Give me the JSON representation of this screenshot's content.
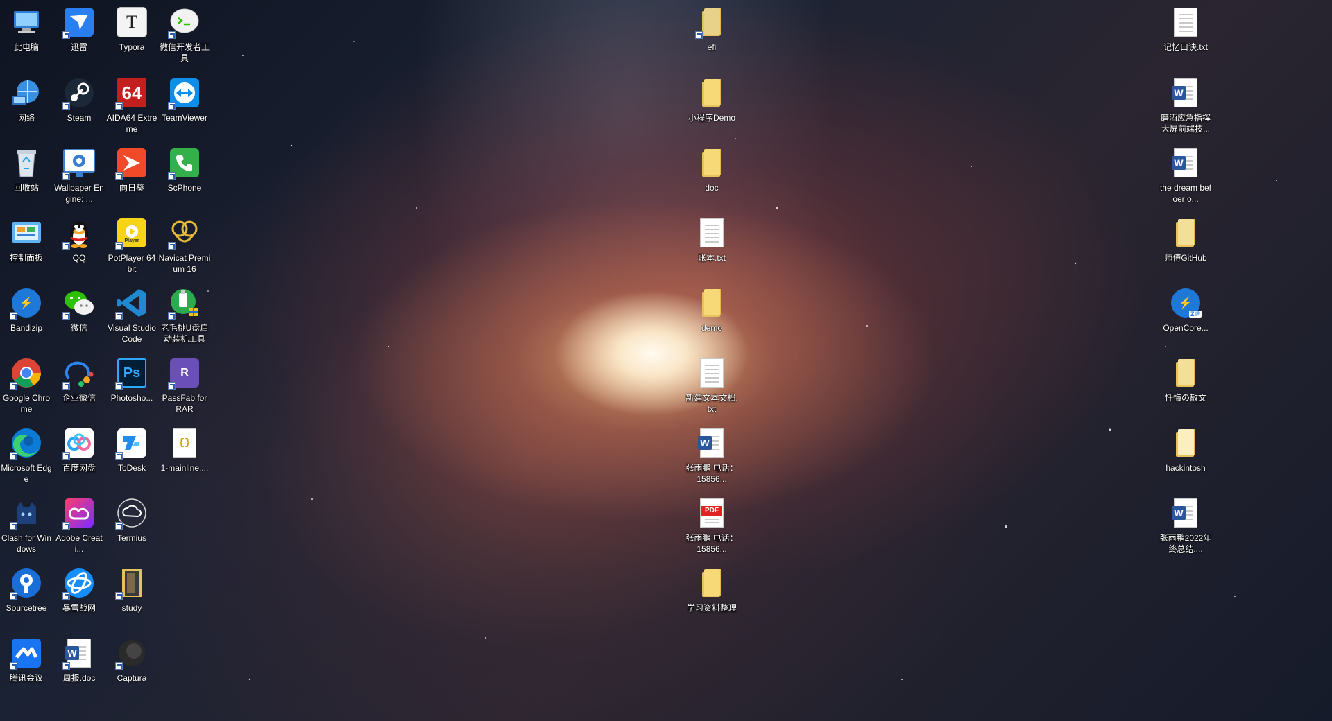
{
  "desktop": {
    "left_columns": [
      [
        "此电脑",
        "网络",
        "回收站",
        "控制面板",
        "Bandizip",
        "Google Chrome",
        "Microsoft Edge",
        "Clash for Windows",
        "Sourcetree",
        "腾讯会议"
      ],
      [
        "迅雷",
        "Steam",
        "Wallpaper Engine: ...",
        "QQ",
        "微信",
        "企业微信",
        "百度网盘",
        "Adobe Creati...",
        "暴雪战网",
        "周报.doc"
      ],
      [
        "Typora",
        "AIDA64 Extreme",
        "向日葵",
        "PotPlayer 64 bit",
        "Visual Studio Code",
        "Photosho...",
        "ToDesk",
        "Termius",
        "study",
        "Captura"
      ],
      [
        "微信开发者工具",
        "TeamViewer",
        "ScPhone",
        "Navicat Premium 16",
        "老毛桃U盘启动装机工具",
        "PassFab for RAR",
        "1-mainline...."
      ]
    ],
    "middle_column": [
      "efi",
      "小程序Demo",
      "doc",
      "账本.txt",
      "demo",
      "新建文本文档.txt",
      "张雨鹏 电话：15856...",
      "张雨鹏 电话：15856...",
      "学习资料整理"
    ],
    "right_column": [
      "记忆口诀.txt",
      "磨酒应急指挥大屏前端技...",
      "the dream befoer o...",
      "师傅GitHub",
      "OpenCore...",
      "忏悔の散文",
      "hackintosh",
      "张雨鹏2022年终总结...."
    ]
  }
}
